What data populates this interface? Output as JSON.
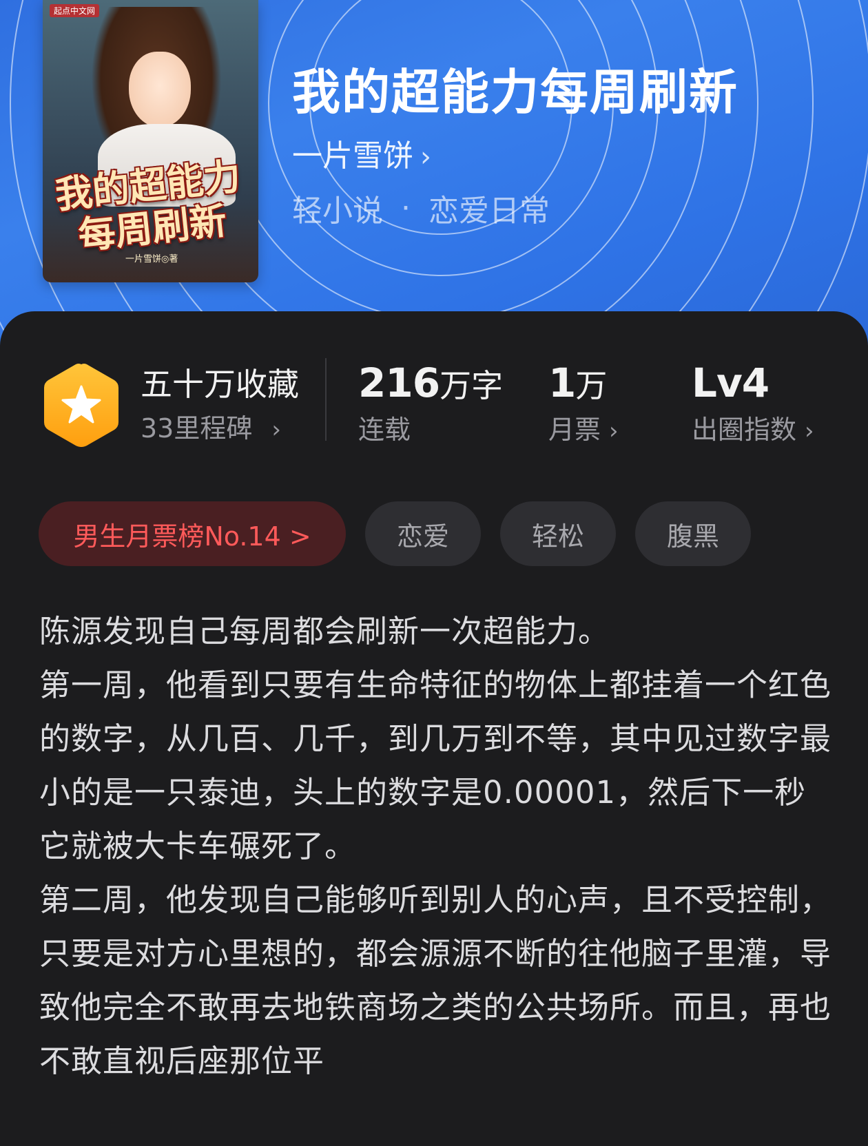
{
  "book": {
    "title": "我的超能力每周刷新",
    "author": "一片雪饼",
    "genre_category": "轻小说",
    "genre_separator": "·",
    "genre_sub": "恋爱日常",
    "cover": {
      "badge": "起点中文网",
      "title": "我的超能力每周刷新",
      "author_line": "一片雪饼◎著"
    }
  },
  "stats": {
    "favorites_label": "五十万收藏",
    "milestone_label": "33里程碑",
    "words_number": "216",
    "words_unit": "万字",
    "words_status": "连载",
    "votes_number": "1",
    "votes_unit": "万",
    "votes_label": "月票",
    "level_value": "Lv4",
    "level_label": "出圈指数"
  },
  "tags": {
    "rank": "男生月票榜No.14 >",
    "items": [
      "恋爱",
      "轻松",
      "腹黑"
    ]
  },
  "description": [
    "陈源发现自己每周都会刷新一次超能力。",
    "第一周，他看到只要有生命特征的物体上都挂着一个红色的数字，从几百、几千，到几万到不等，其中见过数字最小的是一只泰迪，头上的数字是0.00001，然后下一秒它就被大卡车碾死了。",
    "第二周，他发现自己能够听到别人的心声，且不受控制，只要是对方心里想的，都会源源不断的往他脑子里灌，导致他完全不敢再去地铁商场之类的公共场所。而且，再也不敢直视后座那位平"
  ],
  "colors": {
    "header_blue": "#3a80ec",
    "card_bg": "#1c1c1e",
    "rank_red": "#ff5a5a",
    "badge_orange": "#ffb21a"
  },
  "icons": {
    "badge": "star-hexagon-icon",
    "chevron": "chevron-right-icon"
  }
}
